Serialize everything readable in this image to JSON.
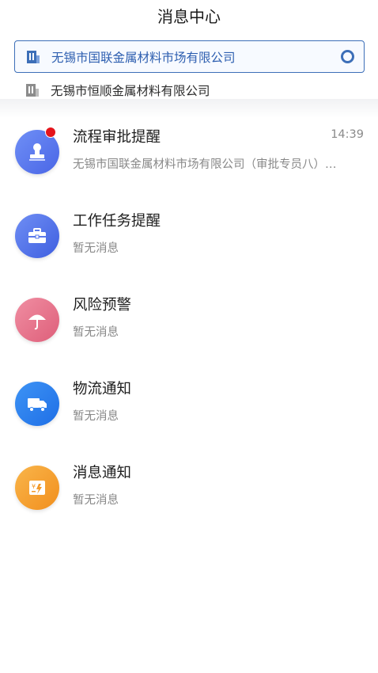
{
  "header": {
    "title": "消息中心"
  },
  "companies": [
    {
      "name": "无锡市国联金属材料市场有限公司",
      "selected": true
    },
    {
      "name": "无锡市恒顺金属材料有限公司",
      "selected": false
    }
  ],
  "items": [
    {
      "title": "流程审批提醒",
      "subtitle": "无锡市国联金属材料市场有限公司（审批专员八）…",
      "time": "14:39",
      "icon": "approval-stamp-icon",
      "color": "#5b7cf0",
      "unread": true
    },
    {
      "title": "工作任务提醒",
      "subtitle": "暂无消息",
      "icon": "briefcase-icon",
      "color": "#4f6fe8"
    },
    {
      "title": "风险预警",
      "subtitle": "暂无消息",
      "icon": "umbrella-icon",
      "color": "#e8728a"
    },
    {
      "title": "物流通知",
      "subtitle": "暂无消息",
      "icon": "truck-icon",
      "color": "#2b7fee"
    },
    {
      "title": "消息通知",
      "subtitle": "暂无消息",
      "icon": "invoice-icon",
      "color": "#f6a132"
    }
  ]
}
